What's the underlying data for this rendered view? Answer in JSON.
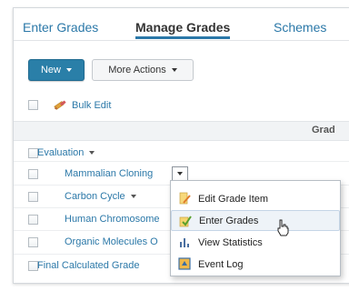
{
  "tabs": [
    "Enter Grades",
    "Manage Grades",
    "Schemes"
  ],
  "toolbar": {
    "new_label": "New",
    "more_label": "More Actions"
  },
  "bulk_edit": "Bulk Edit",
  "table": {
    "header_partial": "Grad",
    "group": "Evaluation",
    "rows": [
      "Mammalian Cloning",
      "Carbon Cycle",
      "Human Chromosome",
      "Organic Molecules O",
      "Final Calculated Grade"
    ]
  },
  "context_menu": {
    "items": [
      {
        "label": "Edit Grade Item",
        "icon": "edit-grade-item-icon"
      },
      {
        "label": "Enter Grades",
        "icon": "enter-grades-icon"
      },
      {
        "label": "View Statistics",
        "icon": "view-statistics-icon"
      },
      {
        "label": "Event Log",
        "icon": "event-log-icon"
      }
    ]
  },
  "colors": {
    "accent": "#2a7fa8",
    "link": "#2b78a8"
  }
}
